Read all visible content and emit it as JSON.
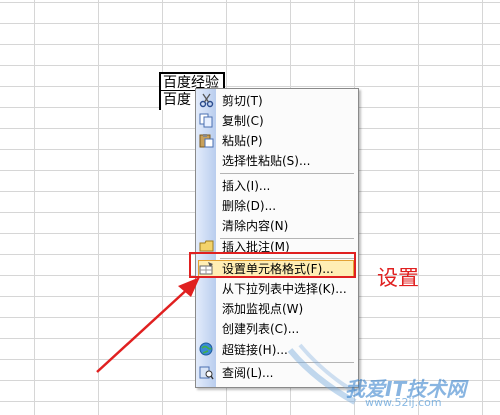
{
  "sheet": {
    "cells": [
      {
        "text": "百度经验"
      },
      {
        "text": "百度"
      }
    ]
  },
  "context_menu": {
    "items": [
      {
        "label": "剪切(T)",
        "icon": "scissors-icon"
      },
      {
        "label": "复制(C)",
        "icon": "copy-icon"
      },
      {
        "label": "粘贴(P)",
        "icon": "paste-icon"
      },
      {
        "label": "选择性粘贴(S)...",
        "icon": ""
      },
      {
        "label": "插入(I)...",
        "icon": ""
      },
      {
        "label": "删除(D)...",
        "icon": ""
      },
      {
        "label": "清除内容(N)",
        "icon": ""
      },
      {
        "label": "插入批注(M)",
        "icon": "comment-icon"
      },
      {
        "label": "设置单元格格式(F)...",
        "icon": "format-cells-icon",
        "highlighted": true
      },
      {
        "label": "从下拉列表中选择(K)...",
        "icon": ""
      },
      {
        "label": "添加监视点(W)",
        "icon": ""
      },
      {
        "label": "创建列表(C)...",
        "icon": ""
      },
      {
        "label": "超链接(H)...",
        "icon": "hyperlink-icon"
      },
      {
        "label": "查阅(L)...",
        "icon": "lookup-icon"
      }
    ]
  },
  "annotation": {
    "label": "设置",
    "color": "#e02020"
  },
  "watermark": {
    "text": "我爱IT技术网",
    "url": "www.52ij.com"
  },
  "colors": {
    "highlight_fill": "#ffeeb4",
    "highlight_border": "#e3a233",
    "menu_strip": "#b9cdee"
  }
}
